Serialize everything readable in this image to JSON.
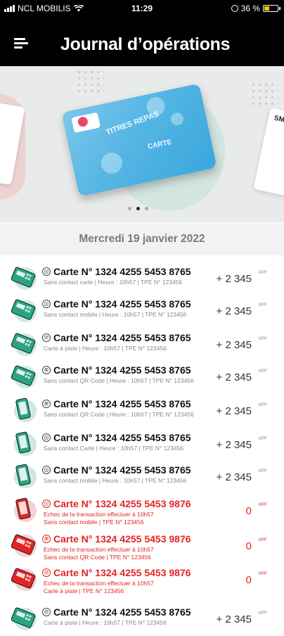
{
  "status_bar": {
    "carrier": "NCL MOBILIS",
    "time": "11:29",
    "battery": "36 %"
  },
  "header": {
    "title": "Journal d’opérations"
  },
  "carousel": {
    "card_text_1": "TITRES REPAS",
    "card_text_2": "CARTE",
    "right_card_text": "SMIL",
    "active_page": 2,
    "pages": 3
  },
  "date_label": "Mercredi 19 janvier 2022",
  "colors": {
    "success": "#2aa57f",
    "success_bg": "#cfe9df",
    "error": "#e52323",
    "error_bg": "#f6d0d0"
  },
  "operations": [
    {
      "card": "Carte N° 1324 4255 5453 8765",
      "detail": "Sans contact carte  |  Heure : 10h57  |  TPE N° 123456",
      "amount": "+ 2 345",
      "currency": "XPF",
      "status": "ok",
      "device": "terminal-icon"
    },
    {
      "card": "Carte N° 1324 4255 5453 8765",
      "detail": "Sans contact mobile  |  Heure : 10h57  |  TPE N° 123456",
      "amount": "+ 2 345",
      "currency": "XPF",
      "status": "ok",
      "device": "terminal-icon"
    },
    {
      "card": "Carte N° 1324 4255 5453 8765",
      "detail": "Carte à piste  |  Heure : 10h57  |  TPE N° 123456",
      "amount": "+ 2 345",
      "currency": "XPF",
      "status": "ok",
      "device": "terminal-icon"
    },
    {
      "card": "Carte N° 1324 4255 5453 8765",
      "detail": "Sans contact QR Code  |  Heure : 10h57  |  TPE N° 123456",
      "amount": "+ 2 345",
      "currency": "XPF",
      "status": "ok",
      "device": "terminal-icon"
    },
    {
      "card": "Carte N° 1324 4255 5453 8765",
      "detail": "Sans contact QR Code  |  Heure : 10h57  |  TPE N° 123456",
      "amount": "+ 2 345",
      "currency": "XPF",
      "status": "ok",
      "device": "phone-icon"
    },
    {
      "card": "Carte N° 1324 4255 5453 8765",
      "detail": "Sans contact Carte  |  Heure : 10h57  |  TPE N° 123456",
      "amount": "+ 2 345",
      "currency": "XPF",
      "status": "ok",
      "device": "phone-icon"
    },
    {
      "card": "Carte N° 1324 4255 5453 8765",
      "detail": "Sans contact mobile  |  Heure : 10h57  |  TPE N° 123456",
      "amount": "+ 2 345",
      "currency": "XPF",
      "status": "ok",
      "device": "phone-icon"
    },
    {
      "card": "Carte N° 1324 4255 5453 9876",
      "detail": "Echec de la transaction effectuer à 10h57",
      "detail2": "Sans contact mobile  |  TPE N° 123456",
      "amount": "0",
      "currency": "XPF",
      "status": "error",
      "device": "phone-icon"
    },
    {
      "card": "Carte N° 1324 4255 5453 9876",
      "detail": "Echec de la transaction effectuer à 10h57",
      "detail2": "Sans contact QR Code  |  TPE N° 123456",
      "amount": "0",
      "currency": "XPF",
      "status": "error",
      "device": "terminal-icon"
    },
    {
      "card": "Carte N° 1324 4255 5453 9876",
      "detail": "Echec de la transaction effectuer à 10h57",
      "detail2": "Carte à piste  |  TPE N° 123456",
      "amount": "0",
      "currency": "XPF",
      "status": "error",
      "device": "terminal-icon"
    },
    {
      "card": "Carte N° 1324 4255 5453 8765",
      "detail": "Carte à piste  |  Heure : 10h57  |  TPE N° 123456",
      "amount": "+ 2 345",
      "currency": "XPF",
      "status": "ok",
      "device": "terminal-icon"
    }
  ]
}
